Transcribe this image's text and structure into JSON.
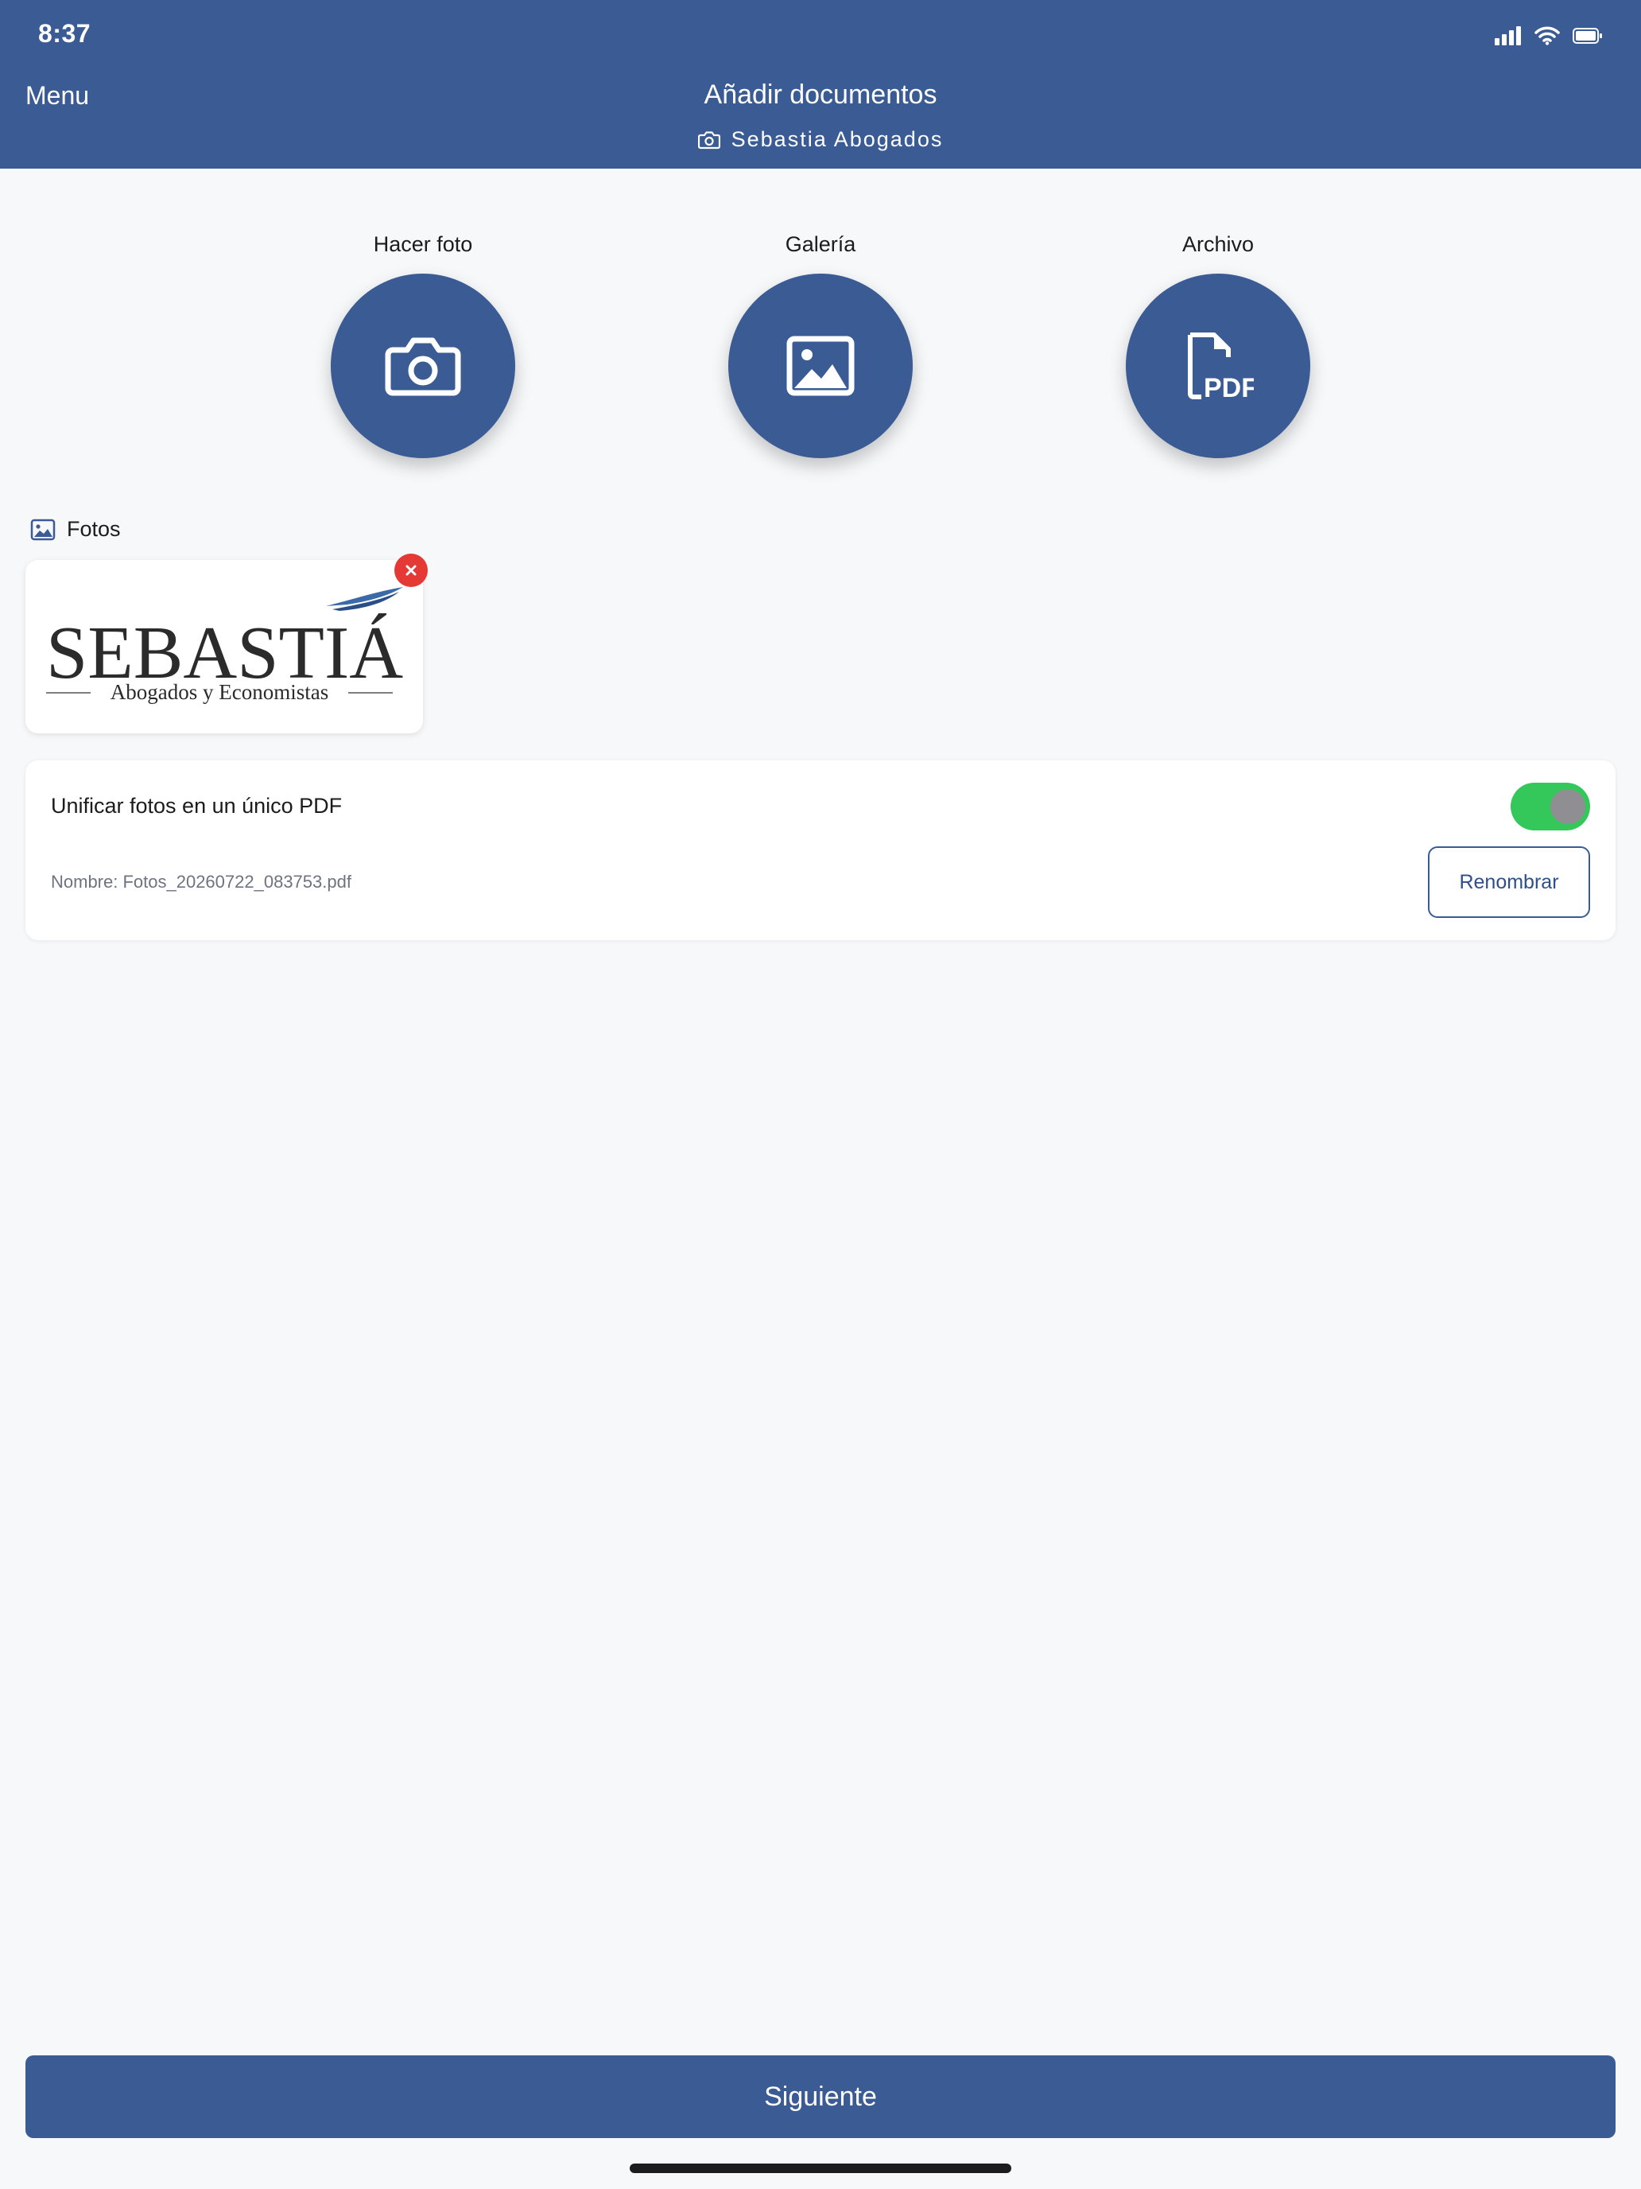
{
  "status_bar": {
    "time": "8:37"
  },
  "header": {
    "menu_label": "Menu",
    "title": "Añadir documentos",
    "subtitle": "Sebastia Abogados"
  },
  "actions": [
    {
      "label": "Hacer foto",
      "icon": "camera-icon"
    },
    {
      "label": "Galería",
      "icon": "image-icon"
    },
    {
      "label": "Archivo",
      "icon": "pdf-file-icon"
    }
  ],
  "photos_section": {
    "label": "Fotos",
    "items": [
      {
        "logo_title": "SEBASTIÁ",
        "logo_subtitle": "Abogados y Economistas"
      }
    ]
  },
  "options": {
    "unify_label": "Unificar fotos en un único PDF",
    "unify_enabled": true,
    "filename": "Nombre: Fotos_20260722_083753.pdf",
    "rename_label": "Renombrar"
  },
  "footer": {
    "next_label": "Siguiente"
  },
  "colors": {
    "primary": "#3a5b93",
    "toggle_on": "#34c759",
    "remove": "#e53935",
    "background": "#f7f8fa"
  }
}
